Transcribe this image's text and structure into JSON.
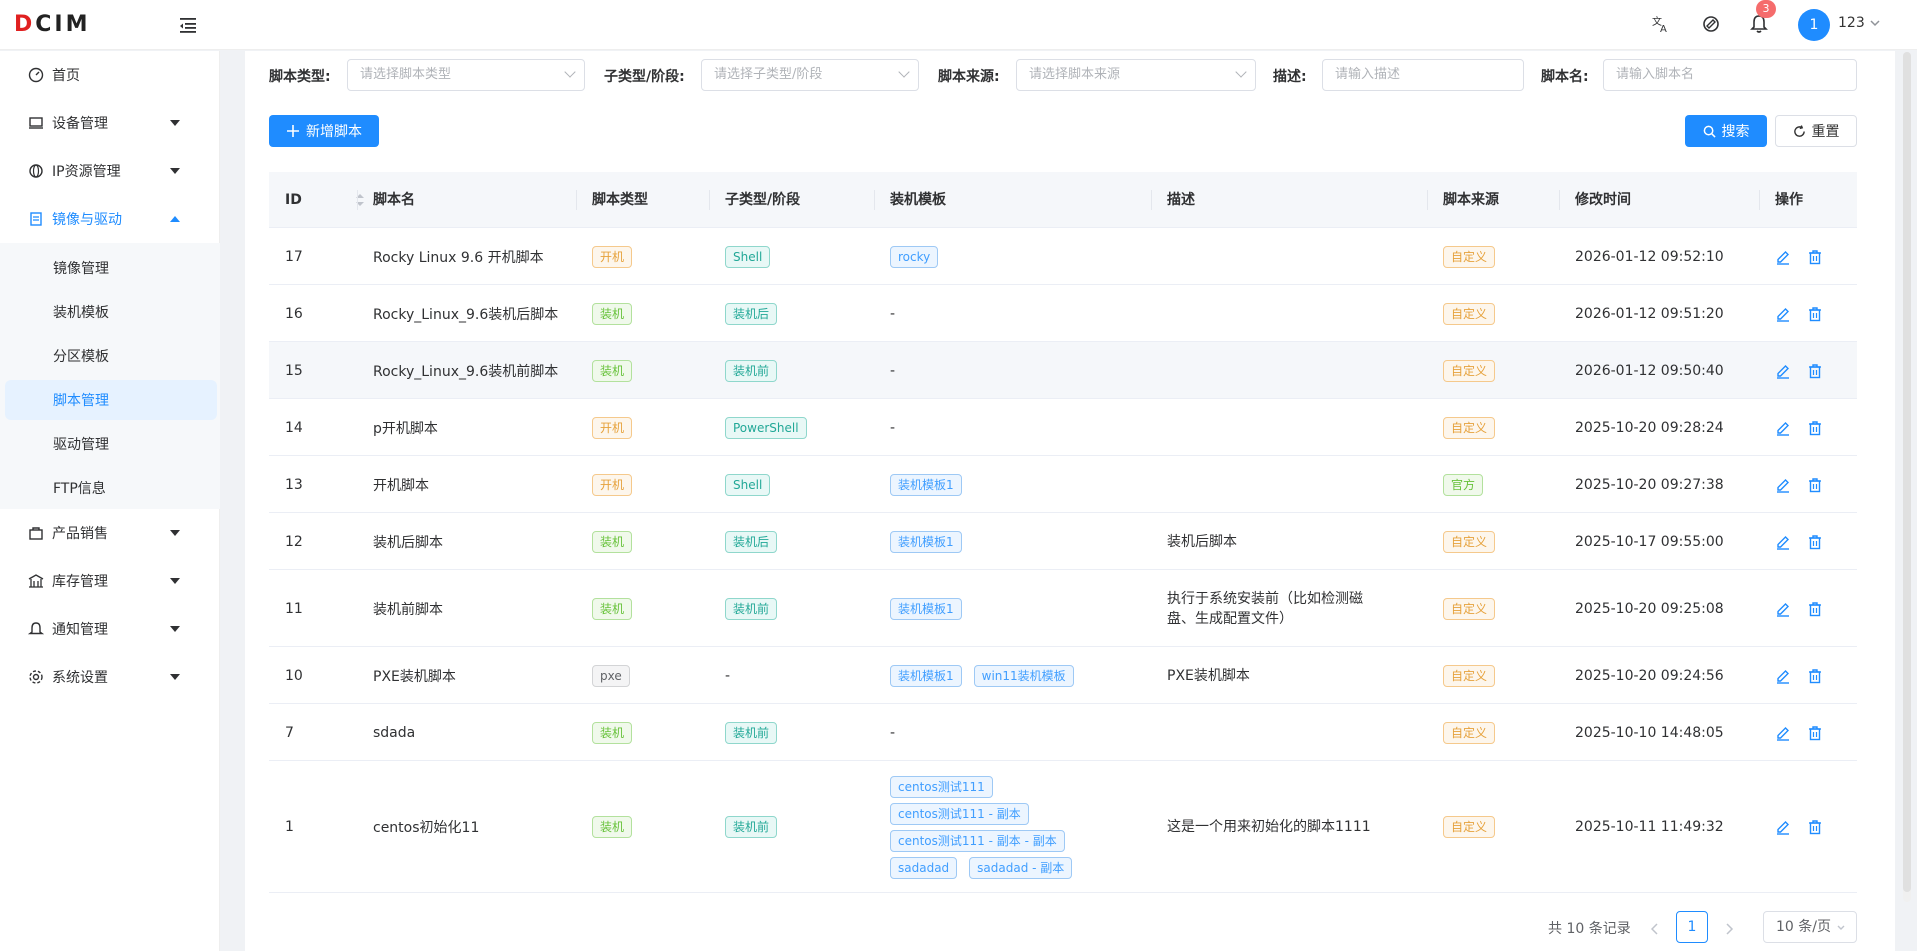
{
  "header": {
    "logo_text": "DCIM",
    "notification_count": "3",
    "avatar_text": "1",
    "username": "123"
  },
  "sidebar": {
    "items": [
      {
        "label": "首页",
        "icon": "dashboard-icon"
      },
      {
        "label": "设备管理",
        "icon": "monitor-icon"
      },
      {
        "label": "IP资源管理",
        "icon": "network-icon"
      },
      {
        "label": "镜像与驱动",
        "icon": "document-icon"
      },
      {
        "label": "产品销售",
        "icon": "bag-icon"
      },
      {
        "label": "库存管理",
        "icon": "warehouse-icon"
      },
      {
        "label": "通知管理",
        "icon": "bell-icon"
      },
      {
        "label": "系统设置",
        "icon": "gear-icon"
      }
    ],
    "sub_items": [
      {
        "label": "镜像管理"
      },
      {
        "label": "装机模板"
      },
      {
        "label": "分区模板"
      },
      {
        "label": "脚本管理"
      },
      {
        "label": "驱动管理"
      },
      {
        "label": "FTP信息"
      }
    ]
  },
  "filters": {
    "type_label": "脚本类型:",
    "type_placeholder": "请选择脚本类型",
    "subtype_label": "子类型/阶段:",
    "subtype_placeholder": "请选择子类型/阶段",
    "source_label": "脚本来源:",
    "source_placeholder": "请选择脚本来源",
    "desc_label": "描述:",
    "desc_placeholder": "请输入描述",
    "name_label": "脚本名:",
    "name_placeholder": "请输入脚本名"
  },
  "toolbar": {
    "add_label": "新增脚本",
    "search_label": "搜索",
    "reset_label": "重置"
  },
  "table": {
    "columns": [
      "ID",
      "脚本名",
      "脚本类型",
      "子类型/阶段",
      "装机模板",
      "描述",
      "脚本来源",
      "修改时间",
      "操作"
    ],
    "rows": [
      {
        "id": "17",
        "name": "Rocky Linux 9.6 开机脚本",
        "type": "开机",
        "subtype": "Shell",
        "templates": [
          "rocky"
        ],
        "desc": "",
        "source": "自定义",
        "time": "2026-01-12 09:52:10"
      },
      {
        "id": "16",
        "name": "Rocky_Linux_9.6装机后脚本",
        "type": "装机",
        "subtype": "装机后",
        "templates": [],
        "desc": "",
        "source": "自定义",
        "time": "2026-01-12 09:51:20"
      },
      {
        "id": "15",
        "name": "Rocky_Linux_9.6装机前脚本",
        "type": "装机",
        "subtype": "装机前",
        "templates": [],
        "desc": "",
        "source": "自定义",
        "time": "2026-01-12 09:50:40"
      },
      {
        "id": "14",
        "name": "p开机脚本",
        "type": "开机",
        "subtype": "PowerShell",
        "templates": [],
        "desc": "",
        "source": "自定义",
        "time": "2025-10-20 09:28:24"
      },
      {
        "id": "13",
        "name": "开机脚本",
        "type": "开机",
        "subtype": "Shell",
        "templates": [
          "装机模板1"
        ],
        "desc": "",
        "source": "官方",
        "time": "2025-10-20 09:27:38"
      },
      {
        "id": "12",
        "name": "装机后脚本",
        "type": "装机",
        "subtype": "装机后",
        "templates": [
          "装机模板1"
        ],
        "desc": "装机后脚本",
        "source": "自定义",
        "time": "2025-10-17 09:55:00"
      },
      {
        "id": "11",
        "name": "装机前脚本",
        "type": "装机",
        "subtype": "装机前",
        "templates": [
          "装机模板1"
        ],
        "desc": "执行于系统安装前（比如检测磁盘、生成配置文件）",
        "source": "自定义",
        "time": "2025-10-20 09:25:08"
      },
      {
        "id": "10",
        "name": "PXE装机脚本",
        "type": "pxe",
        "subtype": "",
        "templates": [
          "装机模板1",
          "win11装机模板"
        ],
        "desc": "PXE装机脚本",
        "source": "自定义",
        "time": "2025-10-20 09:24:56"
      },
      {
        "id": "7",
        "name": "sdada",
        "type": "装机",
        "subtype": "装机前",
        "templates": [],
        "desc": "",
        "source": "自定义",
        "time": "2025-10-10 14:48:05"
      },
      {
        "id": "1",
        "name": "centos初始化11",
        "type": "装机",
        "subtype": "装机前",
        "templates": [
          "centos测试111",
          "centos测试111 - 副本",
          "centos测试111 - 副本 - 副本",
          "sadadad",
          "sadadad - 副本"
        ],
        "desc": "这是一个用来初始化的脚本1111",
        "source": "自定义",
        "time": "2025-10-11 11:49:32"
      }
    ],
    "empty_dash": "-"
  },
  "pagination": {
    "total_text": "共 10 条记录",
    "current_page": "1",
    "page_size": "10 条/页"
  },
  "colors": {
    "primary": "#1f8cff",
    "tag_warn": "#e6a23c",
    "tag_success": "#67c23a"
  }
}
